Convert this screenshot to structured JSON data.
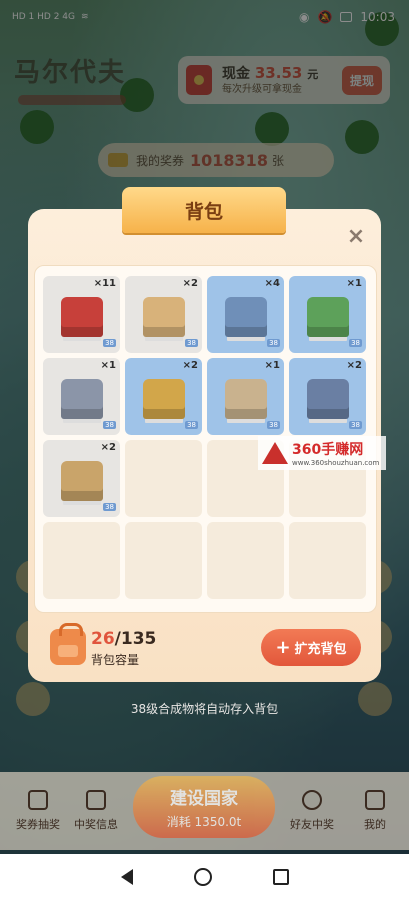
{
  "status_bar": {
    "left": "HD 1  HD 2  4G",
    "time": "10:03",
    "battery": "85"
  },
  "hud": {
    "city_name": "马尔代夫",
    "cash_label": "现金",
    "cash_amount": "33.53",
    "cash_unit": "元",
    "cash_sub": "每次升级可拿现金",
    "withdraw_label": "提现",
    "tickets_label": "我的奖券",
    "tickets_value": "1018318",
    "tickets_unit": "张"
  },
  "modal": {
    "title": "背包",
    "close": "×",
    "items": [
      {
        "name": "forbidden-city",
        "qty": "×11",
        "level": "38",
        "color": "#c7403a"
      },
      {
        "name": "pyramid",
        "qty": "×2",
        "level": "38",
        "color": "#d8b27a"
      },
      {
        "name": "city-skyline",
        "qty": "×4",
        "level": "38",
        "color": "#6f8fb8"
      },
      {
        "name": "turtle-island",
        "qty": "×1",
        "level": "38",
        "color": "#5da15a"
      },
      {
        "name": "oriental-pearl-tower",
        "qty": "×1",
        "level": "38",
        "color": "#8b95a8"
      },
      {
        "name": "golden-monument",
        "qty": "×2",
        "level": "38",
        "color": "#d2a64a"
      },
      {
        "name": "babel-tower",
        "qty": "×1",
        "level": "38",
        "color": "#c9b28e"
      },
      {
        "name": "pirate-ship",
        "qty": "×2",
        "level": "38",
        "color": "#6a7fa3"
      },
      {
        "name": "golden-temple",
        "qty": "×2",
        "level": "38",
        "color": "#c9a46a"
      }
    ],
    "capacity_used": "26",
    "capacity_total": "/135",
    "capacity_label": "背包容量",
    "expand_label": "扩充背包",
    "expand_plus": "+"
  },
  "autosave_note": "38级合成物将自动存入背包",
  "bottom_nav": {
    "lottery": "奖券抽奖",
    "prize_info": "中奖信息",
    "build_title": "建设国家",
    "build_cost": "消耗  1350.0t",
    "friends": "好友中奖",
    "mine": "我的"
  },
  "watermark": {
    "main": "360手赚网",
    "sub": "www.360shouzhuan.com"
  }
}
